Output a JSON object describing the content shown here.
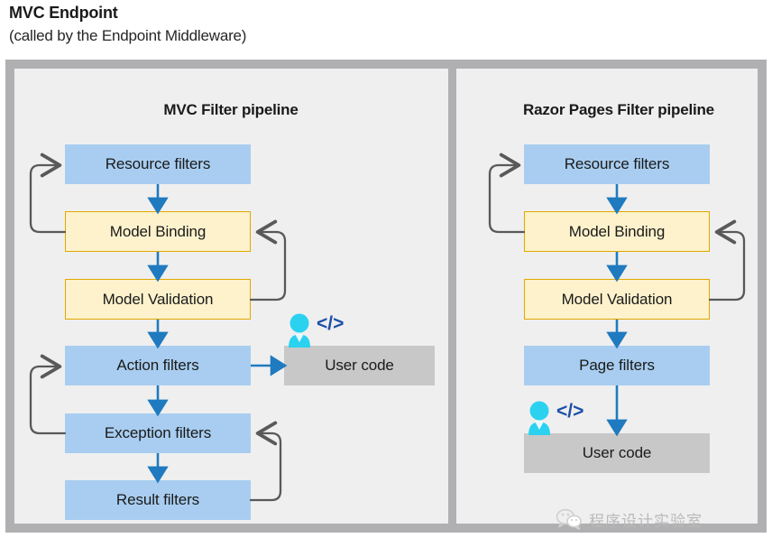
{
  "header": {
    "title": "MVC Endpoint",
    "subtitle": "(called by the Endpoint Middleware)"
  },
  "panels": {
    "mvc": {
      "title": "MVC Filter pipeline",
      "steps": [
        {
          "label": "Resource filters",
          "kind": "blue"
        },
        {
          "label": "Model Binding",
          "kind": "yellow"
        },
        {
          "label": "Model Validation",
          "kind": "yellow"
        },
        {
          "label": "Action filters",
          "kind": "blue"
        },
        {
          "label": "Exception filters",
          "kind": "blue"
        },
        {
          "label": "Result filters",
          "kind": "blue"
        }
      ],
      "user_code": {
        "label": "User code",
        "kind": "gray"
      }
    },
    "razor": {
      "title": "Razor Pages Filter pipeline",
      "steps": [
        {
          "label": "Resource filters",
          "kind": "blue"
        },
        {
          "label": "Model Binding",
          "kind": "yellow"
        },
        {
          "label": "Model Validation",
          "kind": "yellow"
        },
        {
          "label": "Page filters",
          "kind": "blue"
        }
      ],
      "user_code": {
        "label": "User code",
        "kind": "gray"
      }
    }
  },
  "watermark": {
    "text": "程序设计实验室",
    "icon": "wechat-icon"
  },
  "colors": {
    "blue_box": "#a8cdf0",
    "yellow_box": "#fdf2cc",
    "yellow_border": "#e0a800",
    "gray_box": "#c8c8c8",
    "flow_arrow": "#1f7ac0",
    "loop_arrow": "#595959",
    "frame": "#b0b0b3",
    "panel_bg": "#efefef",
    "person_icon": "#2ad2f0",
    "code_glyph": "#1c4fa8"
  }
}
